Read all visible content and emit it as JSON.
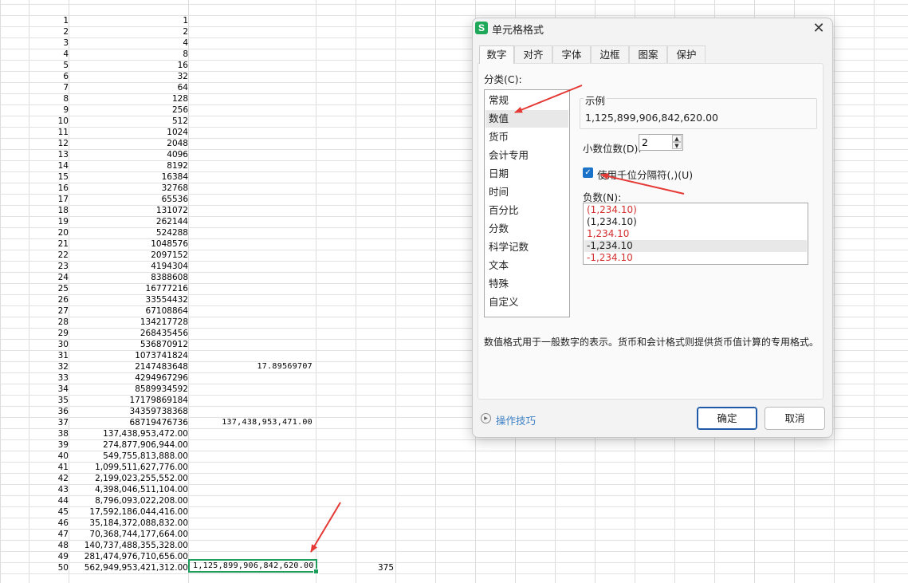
{
  "sheet": {
    "col1": [
      "1",
      "2",
      "3",
      "4",
      "5",
      "6",
      "7",
      "8",
      "9",
      "10",
      "11",
      "12",
      "13",
      "14",
      "15",
      "16",
      "17",
      "18",
      "19",
      "20",
      "21",
      "22",
      "23",
      "24",
      "25",
      "26",
      "27",
      "28",
      "29",
      "30",
      "31",
      "32",
      "33",
      "34",
      "35",
      "36",
      "37",
      "38",
      "39",
      "40",
      "41",
      "42",
      "43",
      "44",
      "45",
      "46",
      "47",
      "48",
      "49",
      "50"
    ],
    "col2": [
      "1",
      "2",
      "4",
      "8",
      "16",
      "32",
      "64",
      "128",
      "256",
      "512",
      "1024",
      "2048",
      "4096",
      "8192",
      "16384",
      "32768",
      "65536",
      "131072",
      "262144",
      "524288",
      "1048576",
      "2097152",
      "4194304",
      "8388608",
      "16777216",
      "33554432",
      "67108864",
      "134217728",
      "268435456",
      "536870912",
      "1073741824",
      "2147483648",
      "4294967296",
      "8589934592",
      "17179869184",
      "34359738368",
      "68719476736",
      "137,438,953,472.00",
      "274,877,906,944.00",
      "549,755,813,888.00",
      "1,099,511,627,776.00",
      "2,199,023,255,552.00",
      "4,398,046,511,104.00",
      "8,796,093,022,208.00",
      "17,592,186,044,416.00",
      "35,184,372,088,832.00",
      "70,368,744,177,664.00",
      "140,737,488,355,328.00",
      "281,474,976,710,656.00",
      "562,949,953,421,312.00"
    ],
    "col3": [
      {
        "row": 32,
        "text": "17.89569707"
      },
      {
        "row": 37,
        "text": "137,438,953,471.00"
      }
    ],
    "selected_cell": "1,125,899,906,842,620.00",
    "col5": [
      {
        "row": 50,
        "text": "375"
      }
    ]
  },
  "dialog": {
    "app_icon": "S",
    "title": "单元格格式",
    "tabs": [
      "数字",
      "对齐",
      "字体",
      "边框",
      "图案",
      "保护"
    ],
    "active_tab": 0,
    "category_label": "分类(C):",
    "categories": [
      "常规",
      "数值",
      "货币",
      "会计专用",
      "日期",
      "时间",
      "百分比",
      "分数",
      "科学记数",
      "文本",
      "特殊",
      "自定义"
    ],
    "selected_category": 1,
    "sample_title": "示例",
    "sample_value": "1,125,899,906,842,620.00",
    "decimal_label": "小数位数(D):",
    "decimal_value": "2",
    "thousands_checked": true,
    "thousands_label": "使用千位分隔符(,)(U)",
    "negative_label": "负数(N):",
    "negative_options": [
      {
        "text": "(1,234.10)",
        "color": "#d32f2f"
      },
      {
        "text": "(1,234.10)",
        "color": "#222222"
      },
      {
        "text": "1,234.10",
        "color": "#d32f2f"
      },
      {
        "text": "-1,234.10",
        "color": "#222222"
      },
      {
        "text": "-1,234.10",
        "color": "#d32f2f"
      }
    ],
    "selected_negative": 3,
    "description": "数值格式用于一般数字的表示。货币和会计格式则提供货币值计算的专用格式。",
    "tips_label": "操作技巧",
    "ok_label": "确定",
    "cancel_label": "取消"
  },
  "colors": {
    "selection_green": "#1e9d5c",
    "annotation_arrow": "#e53935",
    "checkbox_blue": "#1a73c9",
    "link_blue": "#3b7fc4"
  }
}
